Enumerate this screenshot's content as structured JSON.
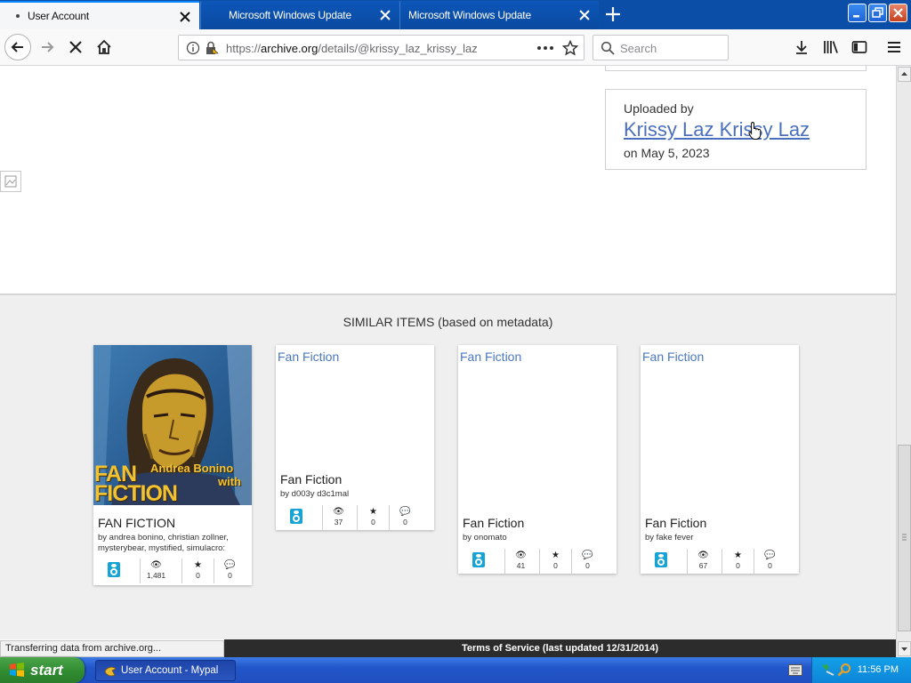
{
  "tabs": [
    {
      "title": "User Account",
      "active": true
    },
    {
      "title": "Microsoft Windows Update",
      "active": false
    },
    {
      "title": "Microsoft Windows Update",
      "active": false
    }
  ],
  "nav": {
    "url_prefix": "https://",
    "url_domain": "archive.org",
    "url_path": "/details/@krissy_laz_krissy_laz",
    "search_placeholder": "Search"
  },
  "uploader": {
    "label": "Uploaded by",
    "name": "Krissy Laz Krissy Laz",
    "date": "on May 5, 2023"
  },
  "similar": {
    "heading": "SIMILAR ITEMS (based on metadata)",
    "items": [
      {
        "title": "FAN FICTION",
        "by": "by andrea bonino, christian zollner, mysterybear, mystified, simulacro:",
        "views": "1,481",
        "favs": "0",
        "reviews": "0",
        "cover_text_1": "FAN",
        "cover_text_2": "FICTION",
        "cover_text_3": "Andrea Bonino",
        "cover_text_4": "with"
      },
      {
        "title_top": "Fan Fiction",
        "title": "Fan Fiction",
        "by": "by d003y d3c1mal",
        "views": "37",
        "favs": "0",
        "reviews": "0"
      },
      {
        "title_top": "Fan Fiction",
        "title": "Fan Fiction",
        "by": "by onomato",
        "views": "41",
        "favs": "0",
        "reviews": "0"
      },
      {
        "title_top": "Fan Fiction",
        "title": "Fan Fiction",
        "by": "by fake fever",
        "views": "67",
        "favs": "0",
        "reviews": "0"
      }
    ]
  },
  "status": "Transferring data from archive.org...",
  "footer": "Terms of Service (last updated 12/31/2014)",
  "taskbar": {
    "start": "start",
    "window": "User Account - Mypal",
    "clock": "11:56 PM"
  },
  "icons": {
    "eye": "👁",
    "star": "★",
    "comment": "💬"
  }
}
